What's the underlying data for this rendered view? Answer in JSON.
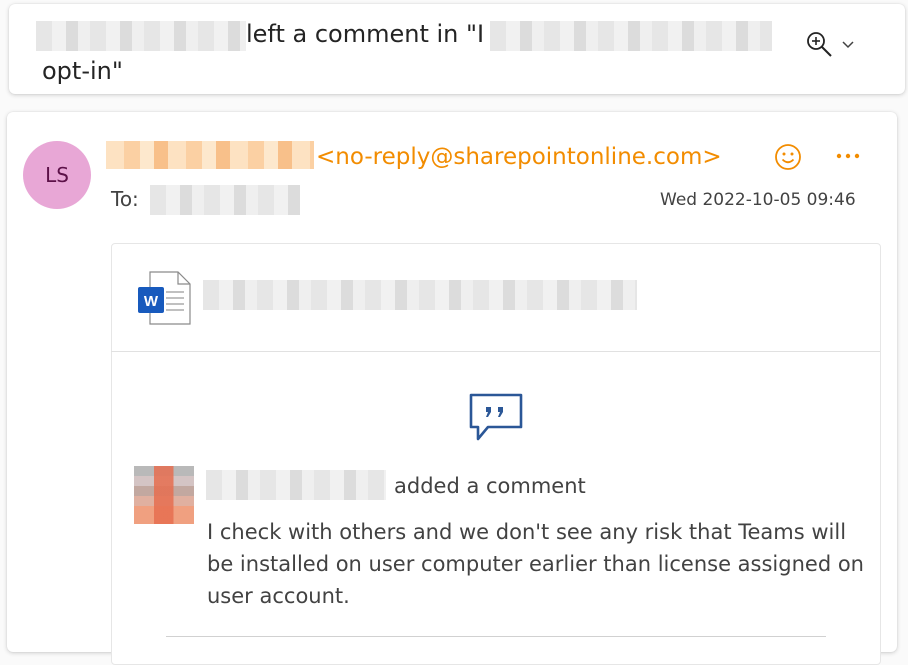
{
  "subject": {
    "line1_text": "left a comment in \"I",
    "line2_text": "opt-in\""
  },
  "message": {
    "avatar_initials": "LS",
    "avatar_color": "#e8a7d6",
    "sender_email": "<no-reply@sharepointonline.com>",
    "accent_color": "#f28c00",
    "to_label": "To:",
    "date": "Wed 2022-10-05 09:46"
  },
  "notification": {
    "file_icon": "word-doc-icon",
    "comment_icon": "speech-bubble-icon",
    "added_comment_text": "added a comment",
    "comment_text": "I check with others and we don't see any risk that Teams will be installed on user computer earlier than license assigned on user account."
  },
  "icons": {
    "zoom": "zoom-in-icon",
    "chevron": "chevron-down-icon",
    "emoji": "smiley-icon",
    "more": "more-icon"
  }
}
